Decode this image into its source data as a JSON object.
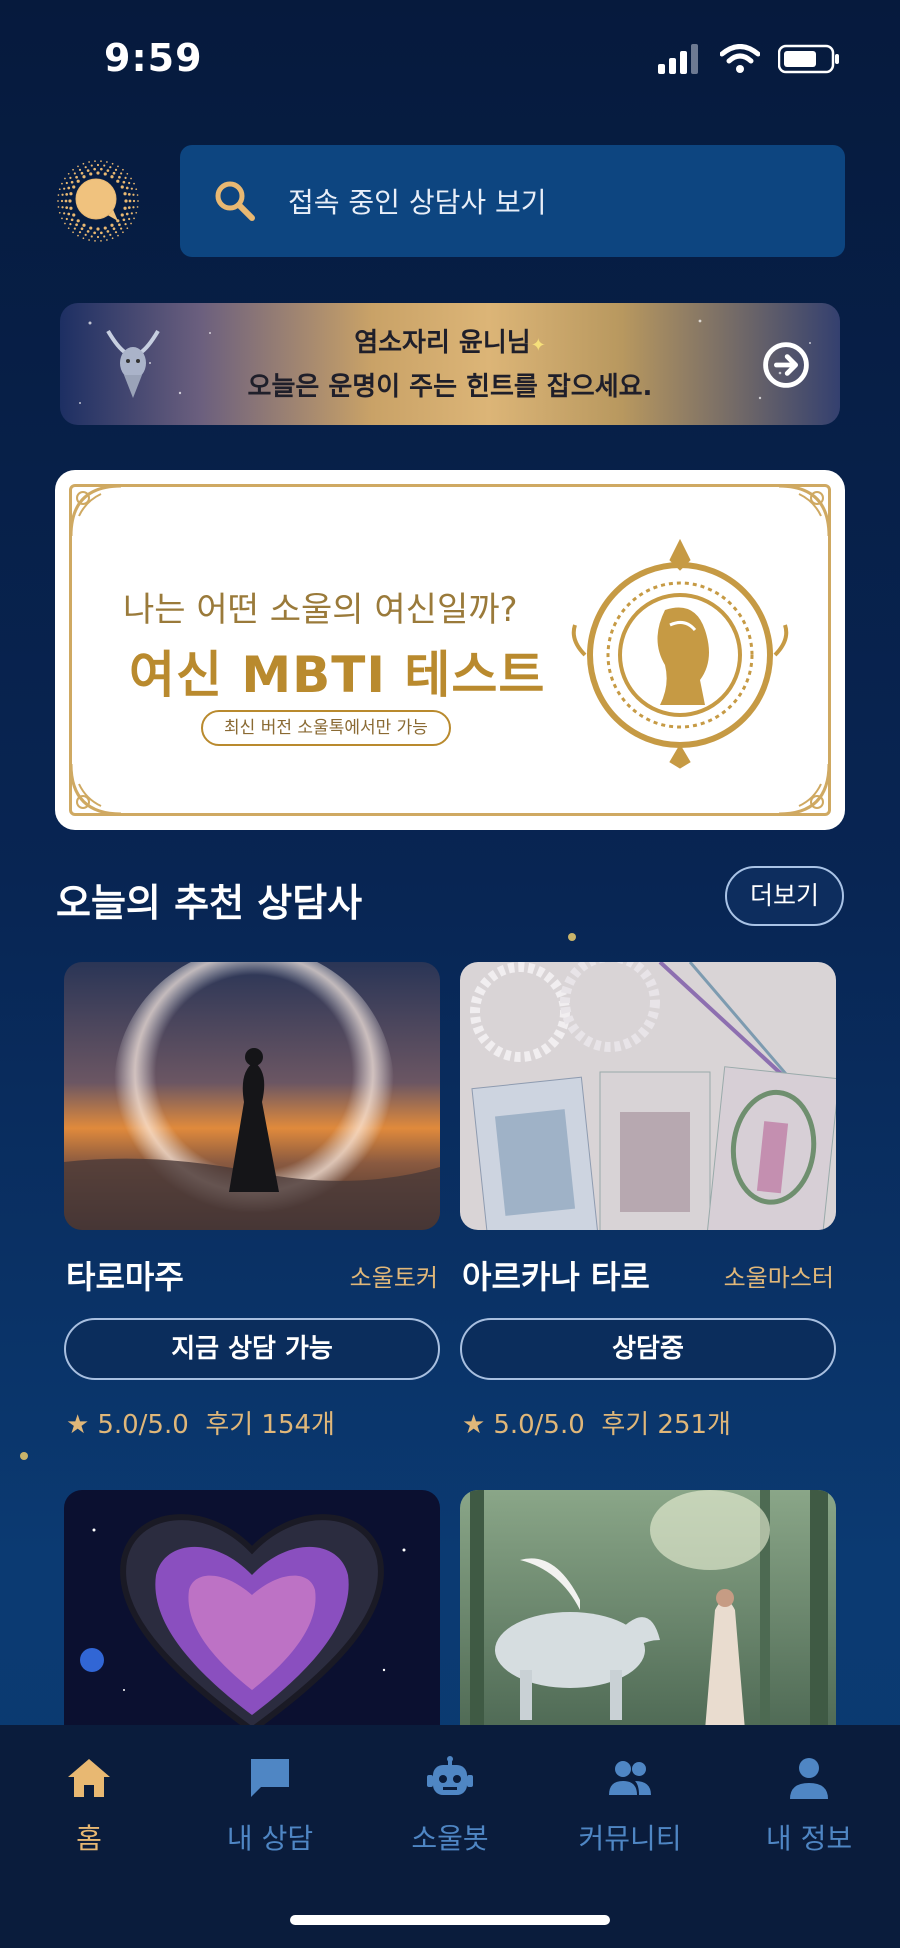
{
  "status_bar": {
    "time": "9:59"
  },
  "search": {
    "placeholder": "접속 중인 상담사 보기"
  },
  "zodiac_banner": {
    "line1": "염소자리 윤니님",
    "line2": "오늘은 운명이 주는 힌트를 잡으세요."
  },
  "mbti_banner": {
    "subtitle": "나는 어떤 소울의 여신일까?",
    "title": "여신 MBTI 테스트",
    "pill": "최신 버전 소울톡에서만 가능"
  },
  "recommended": {
    "title": "오늘의 추천 상담사",
    "more_label": "더보기",
    "cards": [
      {
        "name": "타로마주",
        "grade": "소울토커",
        "status": "지금 상담 가능",
        "rating": "5.0/5.0",
        "reviews": "후기 154개"
      },
      {
        "name": "아르카나 타로",
        "grade": "소울마스터",
        "status": "상담중",
        "rating": "5.0/5.0",
        "reviews": "후기 251개"
      }
    ]
  },
  "tab_bar": {
    "items": [
      {
        "label": "홈",
        "icon": "home-icon"
      },
      {
        "label": "내 상담",
        "icon": "chat-icon"
      },
      {
        "label": "소울봇",
        "icon": "robot-icon"
      },
      {
        "label": "커뮤니티",
        "icon": "people-icon"
      },
      {
        "label": "내 정보",
        "icon": "person-icon"
      }
    ]
  },
  "colors": {
    "accent_gold": "#e0b779",
    "tab_inactive": "#4f86c4",
    "background": "#082553"
  }
}
